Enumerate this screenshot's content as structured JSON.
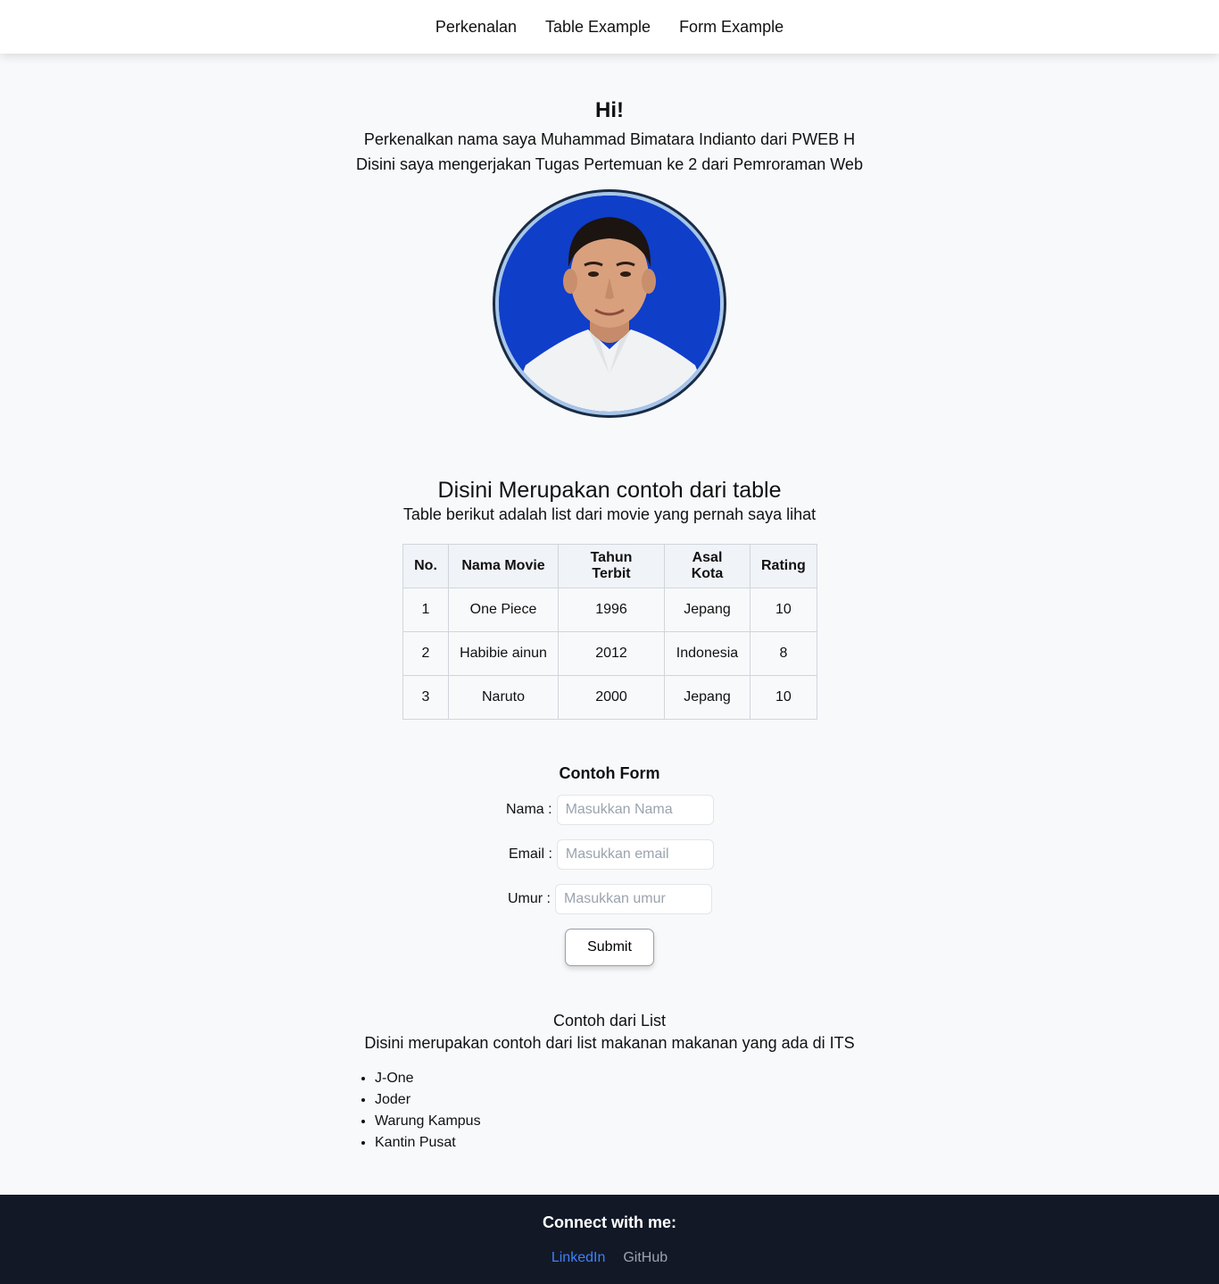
{
  "nav": {
    "items": [
      {
        "label": "Perkenalan"
      },
      {
        "label": "Table Example"
      },
      {
        "label": "Form Example"
      }
    ]
  },
  "intro": {
    "greeting": "Hi!",
    "line1": "Perkenalkan nama saya Muhammad Bimatara Indianto dari PWEB H",
    "line2": "Disini saya mengerjakan Tugas Pertemuan ke 2 dari Pemroraman Web"
  },
  "table_section": {
    "title": "Disini Merupakan contoh dari table",
    "subtitle": "Table berikut adalah list dari movie yang pernah saya lihat",
    "headers": [
      "No.",
      "Nama Movie",
      "Tahun Terbit",
      "Asal Kota",
      "Rating"
    ],
    "rows": [
      [
        "1",
        "One Piece",
        "1996",
        "Jepang",
        "10"
      ],
      [
        "2",
        "Habibie ainun",
        "2012",
        "Indonesia",
        "8"
      ],
      [
        "3",
        "Naruto",
        "2000",
        "Jepang",
        "10"
      ]
    ]
  },
  "form": {
    "title": "Contoh Form",
    "nama_label": "Nama :",
    "nama_placeholder": "Masukkan Nama",
    "email_label": "Email :",
    "email_placeholder": "Masukkan email",
    "umur_label": "Umur :",
    "umur_placeholder": "Masukkan umur",
    "submit_label": "Submit"
  },
  "list_section": {
    "title": "Contoh dari List",
    "subtitle": "Disini merupakan contoh dari list makanan makanan yang ada di ITS",
    "items": [
      "J-One",
      "Joder",
      "Warung Kampus",
      "Kantin Pusat"
    ]
  },
  "footer": {
    "title": "Connect with me:",
    "links": [
      {
        "label": "LinkedIn",
        "color": "#3b82f6"
      },
      {
        "label": "GitHub",
        "color": "#9ca3af"
      }
    ]
  },
  "colors": {
    "page_background": "#f8f9fb",
    "footer_background": "#121826",
    "avatar_background": "#0f3ec9"
  }
}
